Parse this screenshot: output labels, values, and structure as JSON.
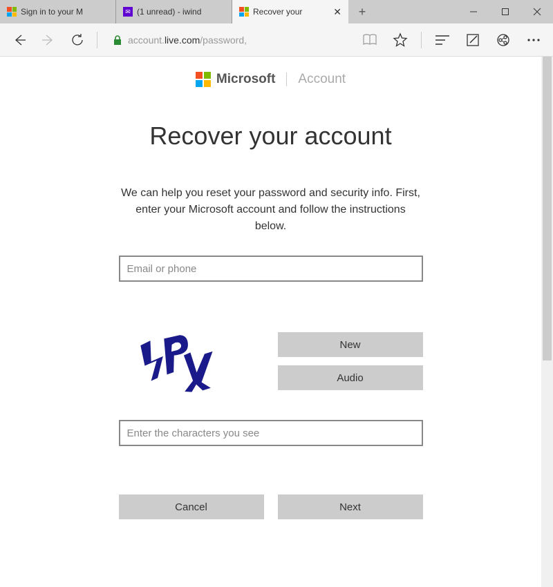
{
  "tabs": [
    {
      "label": "Sign in to your M"
    },
    {
      "label": "(1 unread) - iwind"
    },
    {
      "label": "Recover your"
    }
  ],
  "window_controls": {
    "min": "minimize",
    "max": "maximize",
    "close": "close"
  },
  "toolbar": {
    "url_dark": "live.com",
    "url_pre": "account.",
    "url_post": "/password,"
  },
  "logo": {
    "brand": "Microsoft",
    "section": "Account"
  },
  "page": {
    "heading": "Recover your account",
    "description": "We can help you reset your password and security info. First, enter your Microsoft account and follow the instructions below.",
    "email_placeholder": "Email or phone",
    "captcha_placeholder": "Enter the characters you see",
    "new_label": "New",
    "audio_label": "Audio",
    "cancel_label": "Cancel",
    "next_label": "Next"
  }
}
